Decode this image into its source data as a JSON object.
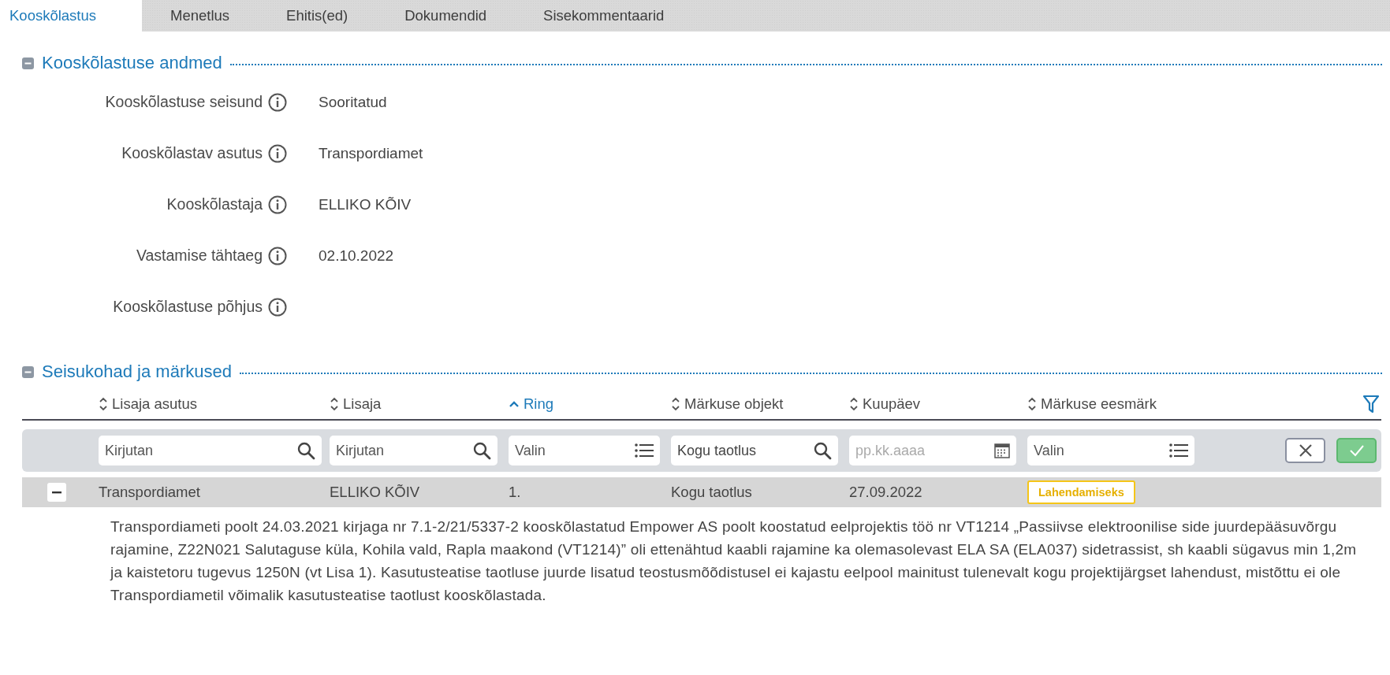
{
  "tabs": [
    {
      "label": "Kooskõlastus",
      "selected": true
    },
    {
      "label": "Menetlus",
      "selected": false
    },
    {
      "label": "Ehitis(ed)",
      "selected": false
    },
    {
      "label": "Dokumendid",
      "selected": false
    },
    {
      "label": "Sisekommentaarid",
      "selected": false
    }
  ],
  "details": {
    "title": "Kooskõlastuse andmed",
    "expanded": true,
    "fields": [
      {
        "label": "Kooskõlastuse seisund",
        "value": "Sooritatud"
      },
      {
        "label": "Kooskõlastav asutus",
        "value": "Transpordiamet"
      },
      {
        "label": "Kooskõlastaja",
        "value": "ELLIKO KÕIV"
      },
      {
        "label": "Vastamise tähtaeg",
        "value": "02.10.2022"
      },
      {
        "label": "Kooskõlastuse põhjus"
      }
    ]
  },
  "remarks": {
    "title": "Seisukohad ja märkused",
    "expanded": true,
    "columns": [
      {
        "label": "Lisaja asutus",
        "sorted": false
      },
      {
        "label": "Lisaja",
        "sorted": false
      },
      {
        "label": "Ring",
        "sorted": true
      },
      {
        "label": "Märkuse objekt",
        "sorted": false
      },
      {
        "label": "Kuupäev",
        "sorted": false
      },
      {
        "label": "Märkuse eesmärk",
        "sorted": false
      }
    ],
    "filters": [
      {
        "kind": "search",
        "placeholder": "Kirjutan"
      },
      {
        "kind": "search",
        "placeholder": "Kirjutan"
      },
      {
        "kind": "list",
        "placeholder": "Valin"
      },
      {
        "kind": "search",
        "value": "Kogu taotlus"
      },
      {
        "kind": "date",
        "placeholder": "pp.kk.aaaa"
      },
      {
        "kind": "list",
        "placeholder": "Valin"
      }
    ],
    "rows": [
      {
        "expanded": true,
        "cells": [
          "Transpordiamet",
          "ELLIKO KÕIV",
          "1.",
          "Kogu taotlus",
          "27.09.2022"
        ],
        "badge": "Lahendamiseks",
        "text": "Transpordiameti poolt 24.03.2021 kirjaga nr 7.1-2/21/5337-2 kooskõlastatud Empower AS poolt koostatud eelprojektis töö nr VT1214 „Passiivse elektroonilise side juurdepääsuvõrgu rajamine, Z22N021 Salutaguse küla, Kohila vald, Rapla maakond (VT1214)” oli ettenähtud kaabli rajamine ka olemasolevast ELA SA (ELA037) sidetrassist, sh kaabli sügavus min 1,2m ja kaistetoru tugevus 1250N (vt Lisa 1). Kasutusteatise taotluse juurde lisatud teostusmõõdistusel ei kajastu eelpool mainitust tulenevalt kogu projektijärgset lahendust, mistõttu ei ole Transpordiametil võimalik kasutusteatise taotlust kooskõlastada."
      }
    ]
  }
}
